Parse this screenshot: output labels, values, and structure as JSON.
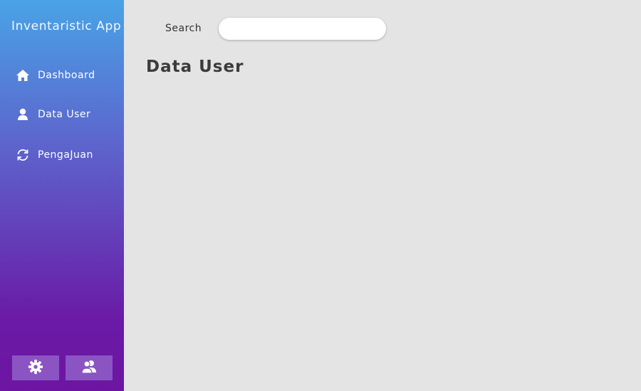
{
  "app": {
    "title": "Inventaristic App"
  },
  "sidebar": {
    "items": [
      {
        "label": "Dashboard",
        "icon": "home-icon"
      },
      {
        "label": "Data User",
        "icon": "user-icon"
      },
      {
        "label": "PengaJuan",
        "icon": "refresh-icon"
      }
    ],
    "bottom_buttons": [
      {
        "icon": "gear-icon"
      },
      {
        "icon": "users-icon"
      }
    ],
    "gradient_colors": [
      "#49a3e6",
      "#5d63cc",
      "#6a1aa6"
    ],
    "button_color": "#8a55c2"
  },
  "search": {
    "label": "Search",
    "value": "",
    "placeholder": ""
  },
  "main": {
    "title": "Data User"
  },
  "colors": {
    "background": "#e4e4e4",
    "title_text": "#3b3b3b"
  }
}
